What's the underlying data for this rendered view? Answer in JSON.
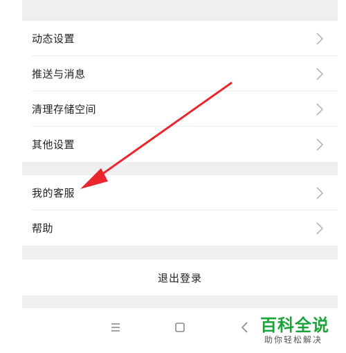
{
  "settings_group_1": {
    "items": [
      {
        "label": "动态设置"
      },
      {
        "label": "推送与消息"
      },
      {
        "label": "清理存储空间"
      },
      {
        "label": "其他设置"
      }
    ]
  },
  "settings_group_2": {
    "items": [
      {
        "label": "我的客服"
      },
      {
        "label": "帮助"
      }
    ]
  },
  "logout": {
    "label": "退出登录"
  },
  "navbar": {
    "menu_icon": "menu-icon",
    "home_icon": "square-home-icon",
    "back_icon": "back-chevron-icon"
  },
  "annotation": {
    "color": "#e8262b"
  },
  "watermark": {
    "title": "百科全说",
    "subtitle": "助你轻松解决",
    "color": "#19a339"
  }
}
